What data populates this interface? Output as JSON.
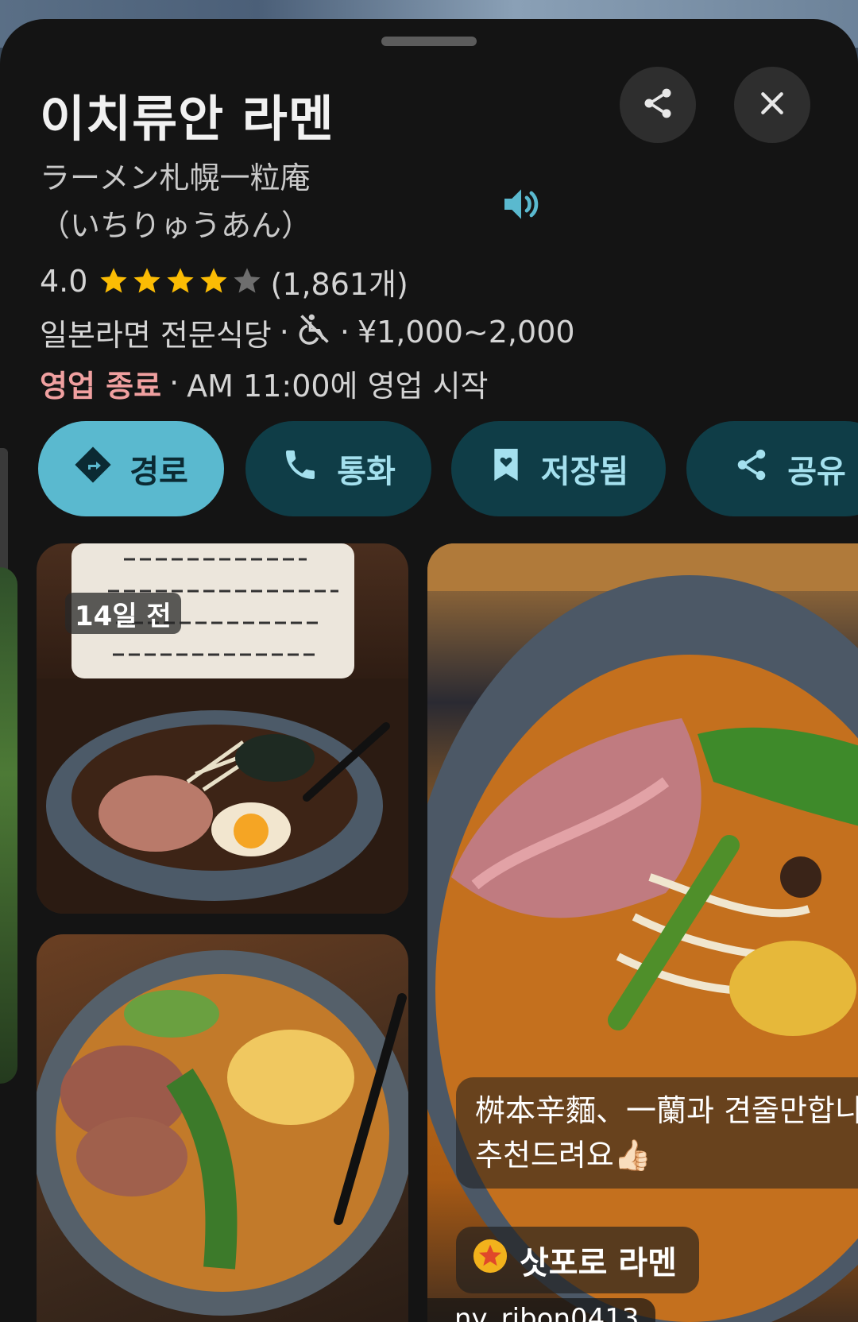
{
  "place": {
    "name": "이치류안 라멘",
    "subtitle_line1": "ラーメン札幌一粒庵",
    "subtitle_line2": "（いちりゅうあん）",
    "rating": "4.0",
    "rating_value": 4,
    "rating_max": 5,
    "review_count": "(1,861개)",
    "category": "일본라면 전문식당",
    "separator": "·",
    "price_range": "¥1,000~2,000",
    "status_closed": "영업 종료",
    "status_detail": "AM 11:00에 영업 시작"
  },
  "actions": {
    "directions": "경로",
    "call": "통화",
    "saved": "저장됨",
    "share": "공유"
  },
  "photos": {
    "badge_time": "14일 전",
    "caption_line1": "桝本辛麵、一蘭과 견줄만합니",
    "caption_line2": "추천드려요👍🏻",
    "tag_label": "삿포로 라멘",
    "username": "ny_ribon0413"
  },
  "colors": {
    "sheet_bg": "#141414",
    "primary_chip": "#5ab9cf",
    "secondary_chip": "#0f3d47",
    "secondary_text": "#a4e0ee",
    "star": "#fbbc04",
    "closed": "#f0a0a0"
  },
  "icons": {
    "share": "share-icon",
    "close": "close-icon",
    "speaker": "speaker-icon",
    "wheelchair": "no-wheelchair-icon",
    "directions": "directions-icon",
    "call": "phone-icon",
    "saved": "bookmark-heart-icon",
    "share_action": "share-icon"
  }
}
